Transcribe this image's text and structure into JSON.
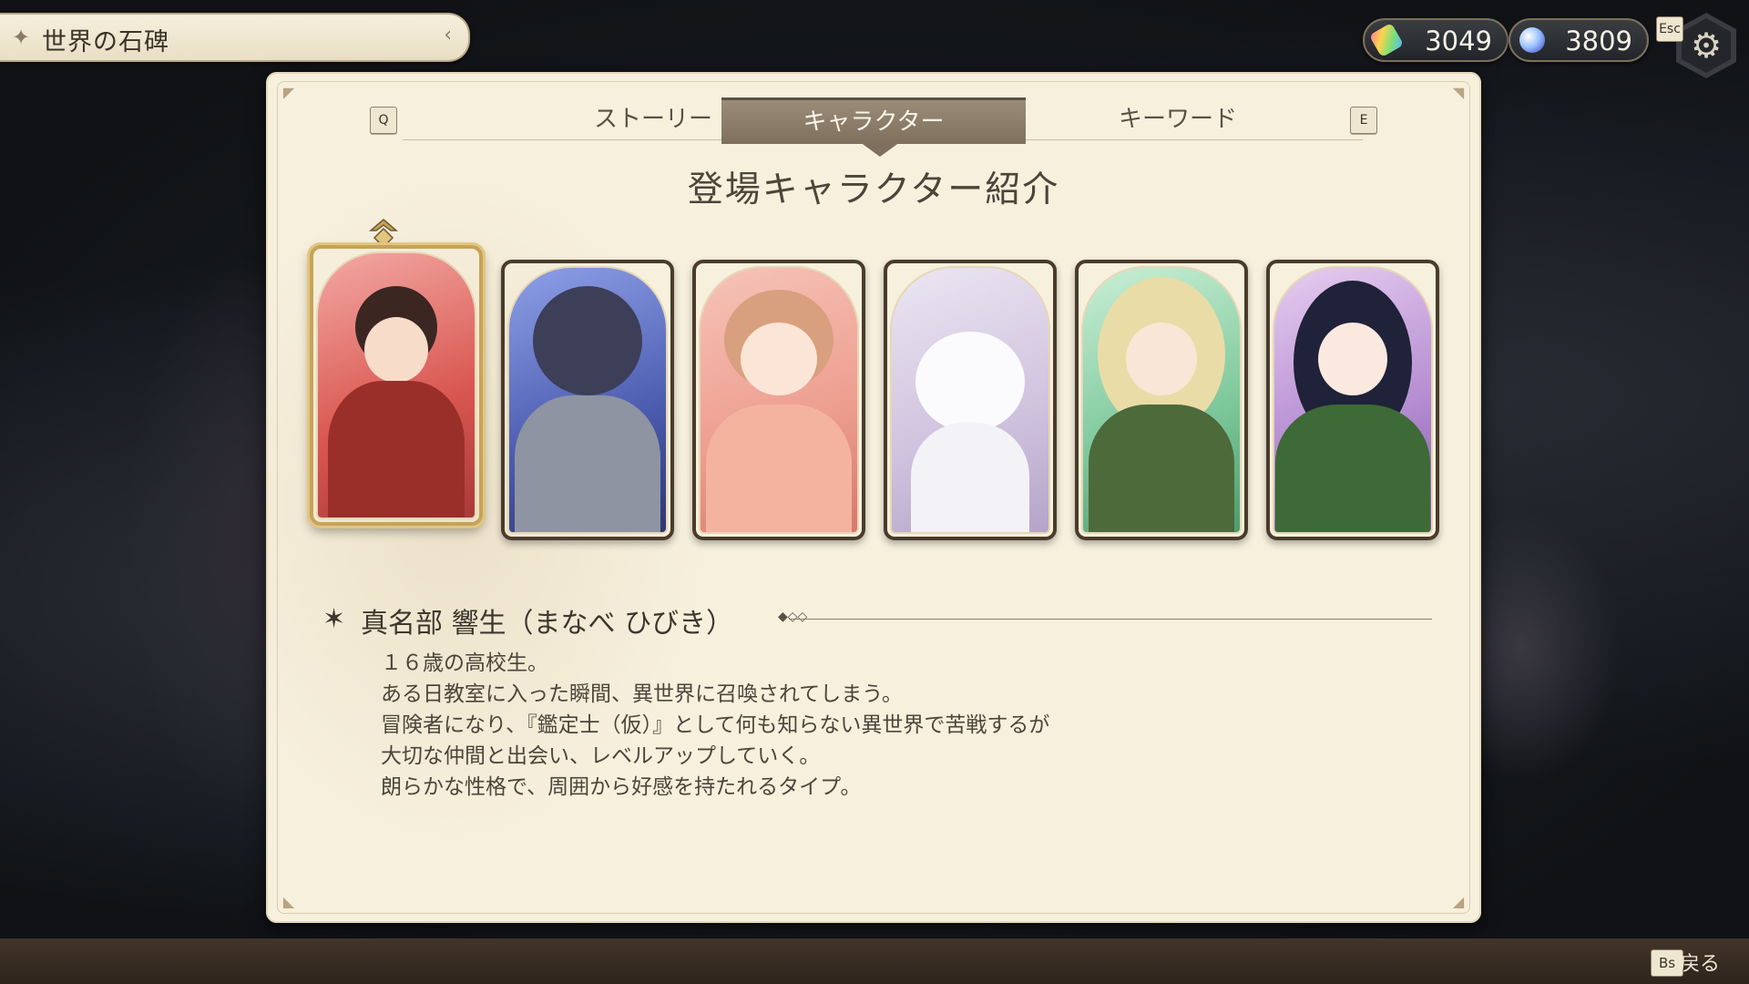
{
  "header": {
    "title": "世界の石碑"
  },
  "currency": {
    "stones": "3049",
    "orbs": "3809"
  },
  "keys": {
    "esc": "Esc",
    "prev_tab": "Q",
    "next_tab": "E",
    "back": "Bs"
  },
  "tabs": [
    {
      "label": "ストーリー",
      "active": false
    },
    {
      "label": "キャラクター",
      "active": true
    },
    {
      "label": "キーワード",
      "active": false
    }
  ],
  "section_title": "登場キャラクター紹介",
  "characters": [
    {
      "icon": "character-portrait-boy-red",
      "selected": true
    },
    {
      "icon": "character-portrait-wolfman-blue",
      "selected": false
    },
    {
      "icon": "character-portrait-girl-peach",
      "selected": false
    },
    {
      "icon": "character-portrait-white-cat",
      "selected": false
    },
    {
      "icon": "character-portrait-elf-green",
      "selected": false
    },
    {
      "icon": "character-portrait-swordswoman-purple",
      "selected": false
    }
  ],
  "selected_character": {
    "name": "真名部 響生（まなべ ひびき）",
    "description": [
      "１６歳の高校生。",
      "ある日教室に入った瞬間、異世界に召喚されてしまう。",
      "冒険者になり、『鑑定士（仮）』として何も知らない異世界で苦戦するが",
      "大切な仲間と出会い、レベルアップしていく。",
      "朗らかな性格で、周囲から好感を持たれるタイプ。"
    ]
  },
  "footer": {
    "back_label": "戻る"
  },
  "colors": {
    "panel": "#f7f0dd",
    "active_tab": "#8a7b67",
    "text": "#4d443a",
    "selected_frame": "#c6a35a"
  }
}
